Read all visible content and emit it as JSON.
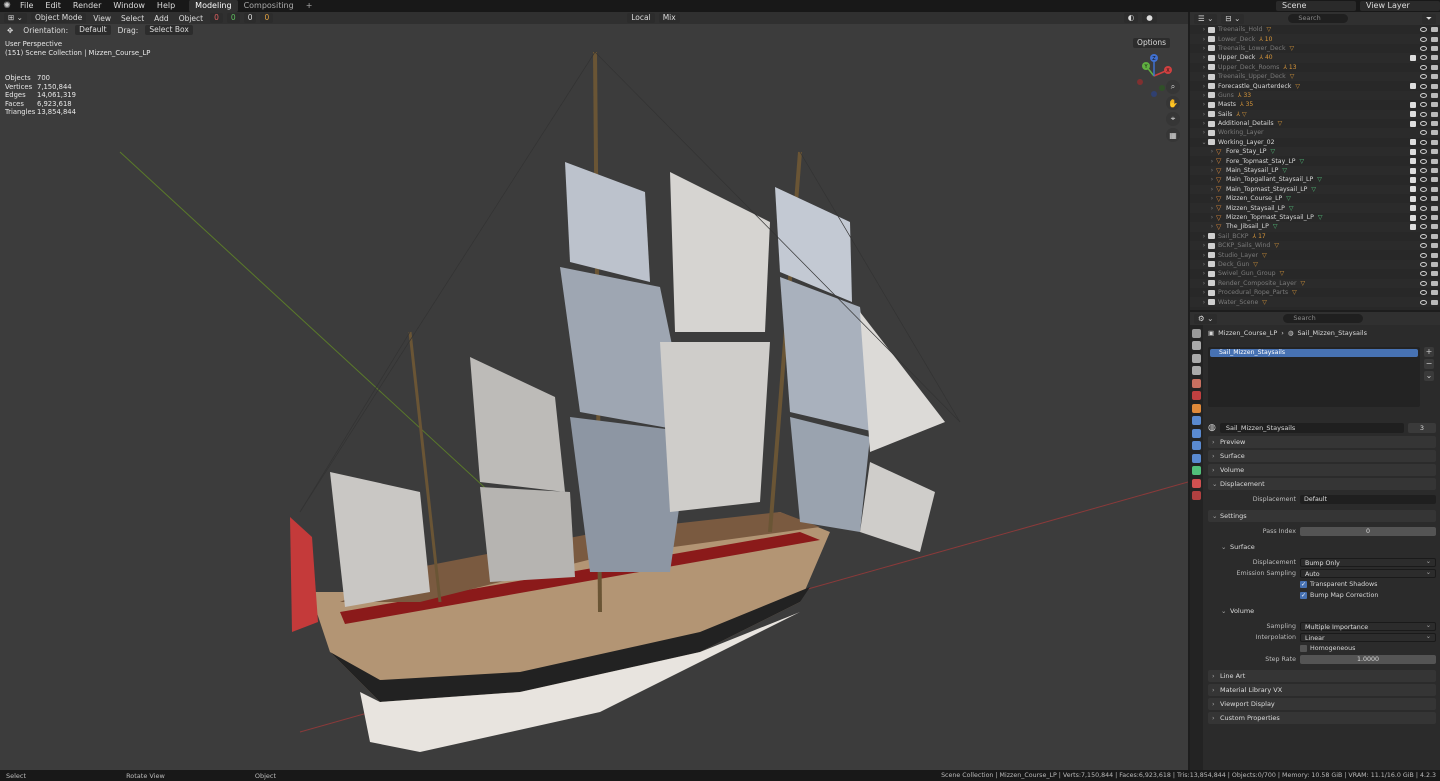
{
  "menubar": {
    "items": [
      "File",
      "Edit",
      "Render",
      "Window",
      "Help"
    ],
    "workspaces": [
      "Modeling",
      "Compositing"
    ],
    "add_workspace": "+",
    "scene": "Scene",
    "view_layer": "View Layer"
  },
  "viewport": {
    "mode": "Object Mode",
    "menus": [
      "View",
      "Select",
      "Add",
      "Object"
    ],
    "counters": [
      "0",
      "0",
      "0",
      "0"
    ],
    "orientation_label": "Orientation:",
    "orientation_value": "Default",
    "drag_label": "Drag:",
    "drag_value": "Select Box",
    "transform_space": "Local",
    "snap_mode": "Mix",
    "options": "Options",
    "info": {
      "perspective": "User Perspective",
      "collection": "(151) Scene Collection | Mizzen_Course_LP"
    },
    "stats": [
      {
        "k": "Objects",
        "v": "700"
      },
      {
        "k": "Vertices",
        "v": "7,150,844"
      },
      {
        "k": "Edges",
        "v": "14,061,319"
      },
      {
        "k": "Faces",
        "v": "6,923,618"
      },
      {
        "k": "Triangles",
        "v": "13,854,844"
      }
    ],
    "gizmo_axes": [
      "X",
      "Y",
      "Z"
    ]
  },
  "outliner": {
    "search_placeholder": "Search",
    "rows": [
      {
        "label": "Treenails_Hold",
        "dim": true,
        "indent": 0,
        "extra": "▽"
      },
      {
        "label": "Lower_Deck",
        "dim": true,
        "indent": 0,
        "extra": "⅄ 10"
      },
      {
        "label": "Treenails_Lower_Deck",
        "dim": true,
        "indent": 0,
        "extra": "▽"
      },
      {
        "label": "Upper_Deck",
        "dim": false,
        "indent": 0,
        "extra": "⅄ 40"
      },
      {
        "label": "Upper_Deck_Rooms",
        "dim": true,
        "indent": 0,
        "extra": "⅄ 13"
      },
      {
        "label": "Treenails_Upper_Deck",
        "dim": true,
        "indent": 0,
        "extra": "▽"
      },
      {
        "label": "Forecastle_Quarterdeck",
        "dim": false,
        "indent": 0,
        "extra": "▽"
      },
      {
        "label": "Guns",
        "dim": true,
        "indent": 0,
        "extra": "⅄ 33"
      },
      {
        "label": "Masts",
        "dim": false,
        "indent": 0,
        "extra": "⅄ 35"
      },
      {
        "label": "Sails",
        "dim": false,
        "indent": 0,
        "extra": "⅄ ▽"
      },
      {
        "label": "Additional_Details",
        "dim": false,
        "indent": 0,
        "extra": "▽"
      },
      {
        "label": "Working_Layer",
        "dim": true,
        "indent": 0,
        "extra": ""
      },
      {
        "label": "Working_Layer_02",
        "dim": false,
        "indent": 0,
        "extra": "",
        "open": true
      },
      {
        "label": "Fore_Stay_LP",
        "dim": false,
        "indent": 1,
        "extra": "▽",
        "green": true
      },
      {
        "label": "Fore_Topmast_Stay_LP",
        "dim": false,
        "indent": 1,
        "extra": "▽",
        "green": true
      },
      {
        "label": "Main_Staysail_LP",
        "dim": false,
        "indent": 1,
        "extra": "▽",
        "green": true
      },
      {
        "label": "Main_Topgallant_Staysail_LP",
        "dim": false,
        "indent": 1,
        "extra": "▽",
        "green": true
      },
      {
        "label": "Main_Topmast_Staysail_LP",
        "dim": false,
        "indent": 1,
        "extra": "▽",
        "green": true
      },
      {
        "label": "Mizzen_Course_LP",
        "dim": false,
        "indent": 1,
        "extra": "▽",
        "green": true
      },
      {
        "label": "Mizzen_Staysail_LP",
        "dim": false,
        "indent": 1,
        "extra": "▽",
        "green": true
      },
      {
        "label": "Mizzen_Topmast_Staysail_LP",
        "dim": false,
        "indent": 1,
        "extra": "▽",
        "green": true
      },
      {
        "label": "The_Jibsail_LP",
        "dim": false,
        "indent": 1,
        "extra": "▽",
        "green": true
      },
      {
        "label": "Sail_BCKP",
        "dim": true,
        "indent": 0,
        "extra": "⅄ 17"
      },
      {
        "label": "BCKP_Sails_Wind",
        "dim": true,
        "indent": 0,
        "extra": "▽"
      },
      {
        "label": "Studio_Layer",
        "dim": true,
        "indent": 0,
        "extra": "▽"
      },
      {
        "label": "Deck_Gun",
        "dim": true,
        "indent": 0,
        "extra": "▽"
      },
      {
        "label": "Swivel_Gun_Group",
        "dim": true,
        "indent": 0,
        "extra": "▽"
      },
      {
        "label": "Render_Composite_Layer",
        "dim": true,
        "indent": 0,
        "extra": "▽"
      },
      {
        "label": "Procedural_Rope_Parts",
        "dim": true,
        "indent": 0,
        "extra": "▽"
      },
      {
        "label": "Water_Scene",
        "dim": true,
        "indent": 0,
        "extra": "▽"
      }
    ]
  },
  "properties": {
    "search_placeholder": "Search",
    "breadcrumb_object": "Mizzen_Course_LP",
    "breadcrumb_material": "Sail_Mizzen_Staysails",
    "slots": [
      "Sail_Mizzen_Staysails"
    ],
    "material_name": "Sail_Mizzen_Staysails",
    "material_users": "3",
    "panels": {
      "preview": "Preview",
      "surface": "Surface",
      "volume": "Volume",
      "displacement": "Displacement",
      "settings": "Settings",
      "line_art": "Line Art",
      "material_library": "Material Library VX",
      "viewport_display": "Viewport Display",
      "custom_properties": "Custom Properties"
    },
    "displacement_label": "Displacement",
    "displacement_value": "Default",
    "pass_index_label": "Pass Index",
    "pass_index_value": "0",
    "surface_sub": "Surface",
    "surface_displacement_label": "Displacement",
    "surface_displacement_value": "Bump Only",
    "emission_sampling_label": "Emission Sampling",
    "emission_sampling_value": "Auto",
    "transparent_shadows": "Transparent Shadows",
    "bump_map_correction": "Bump Map Correction",
    "volume_sub": "Volume",
    "sampling_label": "Sampling",
    "sampling_value": "Multiple Importance",
    "interpolation_label": "Interpolation",
    "interpolation_value": "Linear",
    "homogeneous": "Homogeneous",
    "step_rate_label": "Step Rate",
    "step_rate_value": "1.0000"
  },
  "statusbar": {
    "select": "Select",
    "rotate": "Rotate View",
    "object": "Object",
    "info": "Scene Collection | Mizzen_Course_LP | Verts:7,150,844 | Faces:6,923,618 | Tris:13,854,844 | Objects:0/700 | Memory: 10.58 GiB | VRAM: 11.1/16.0 GiB | 4.2.3"
  }
}
